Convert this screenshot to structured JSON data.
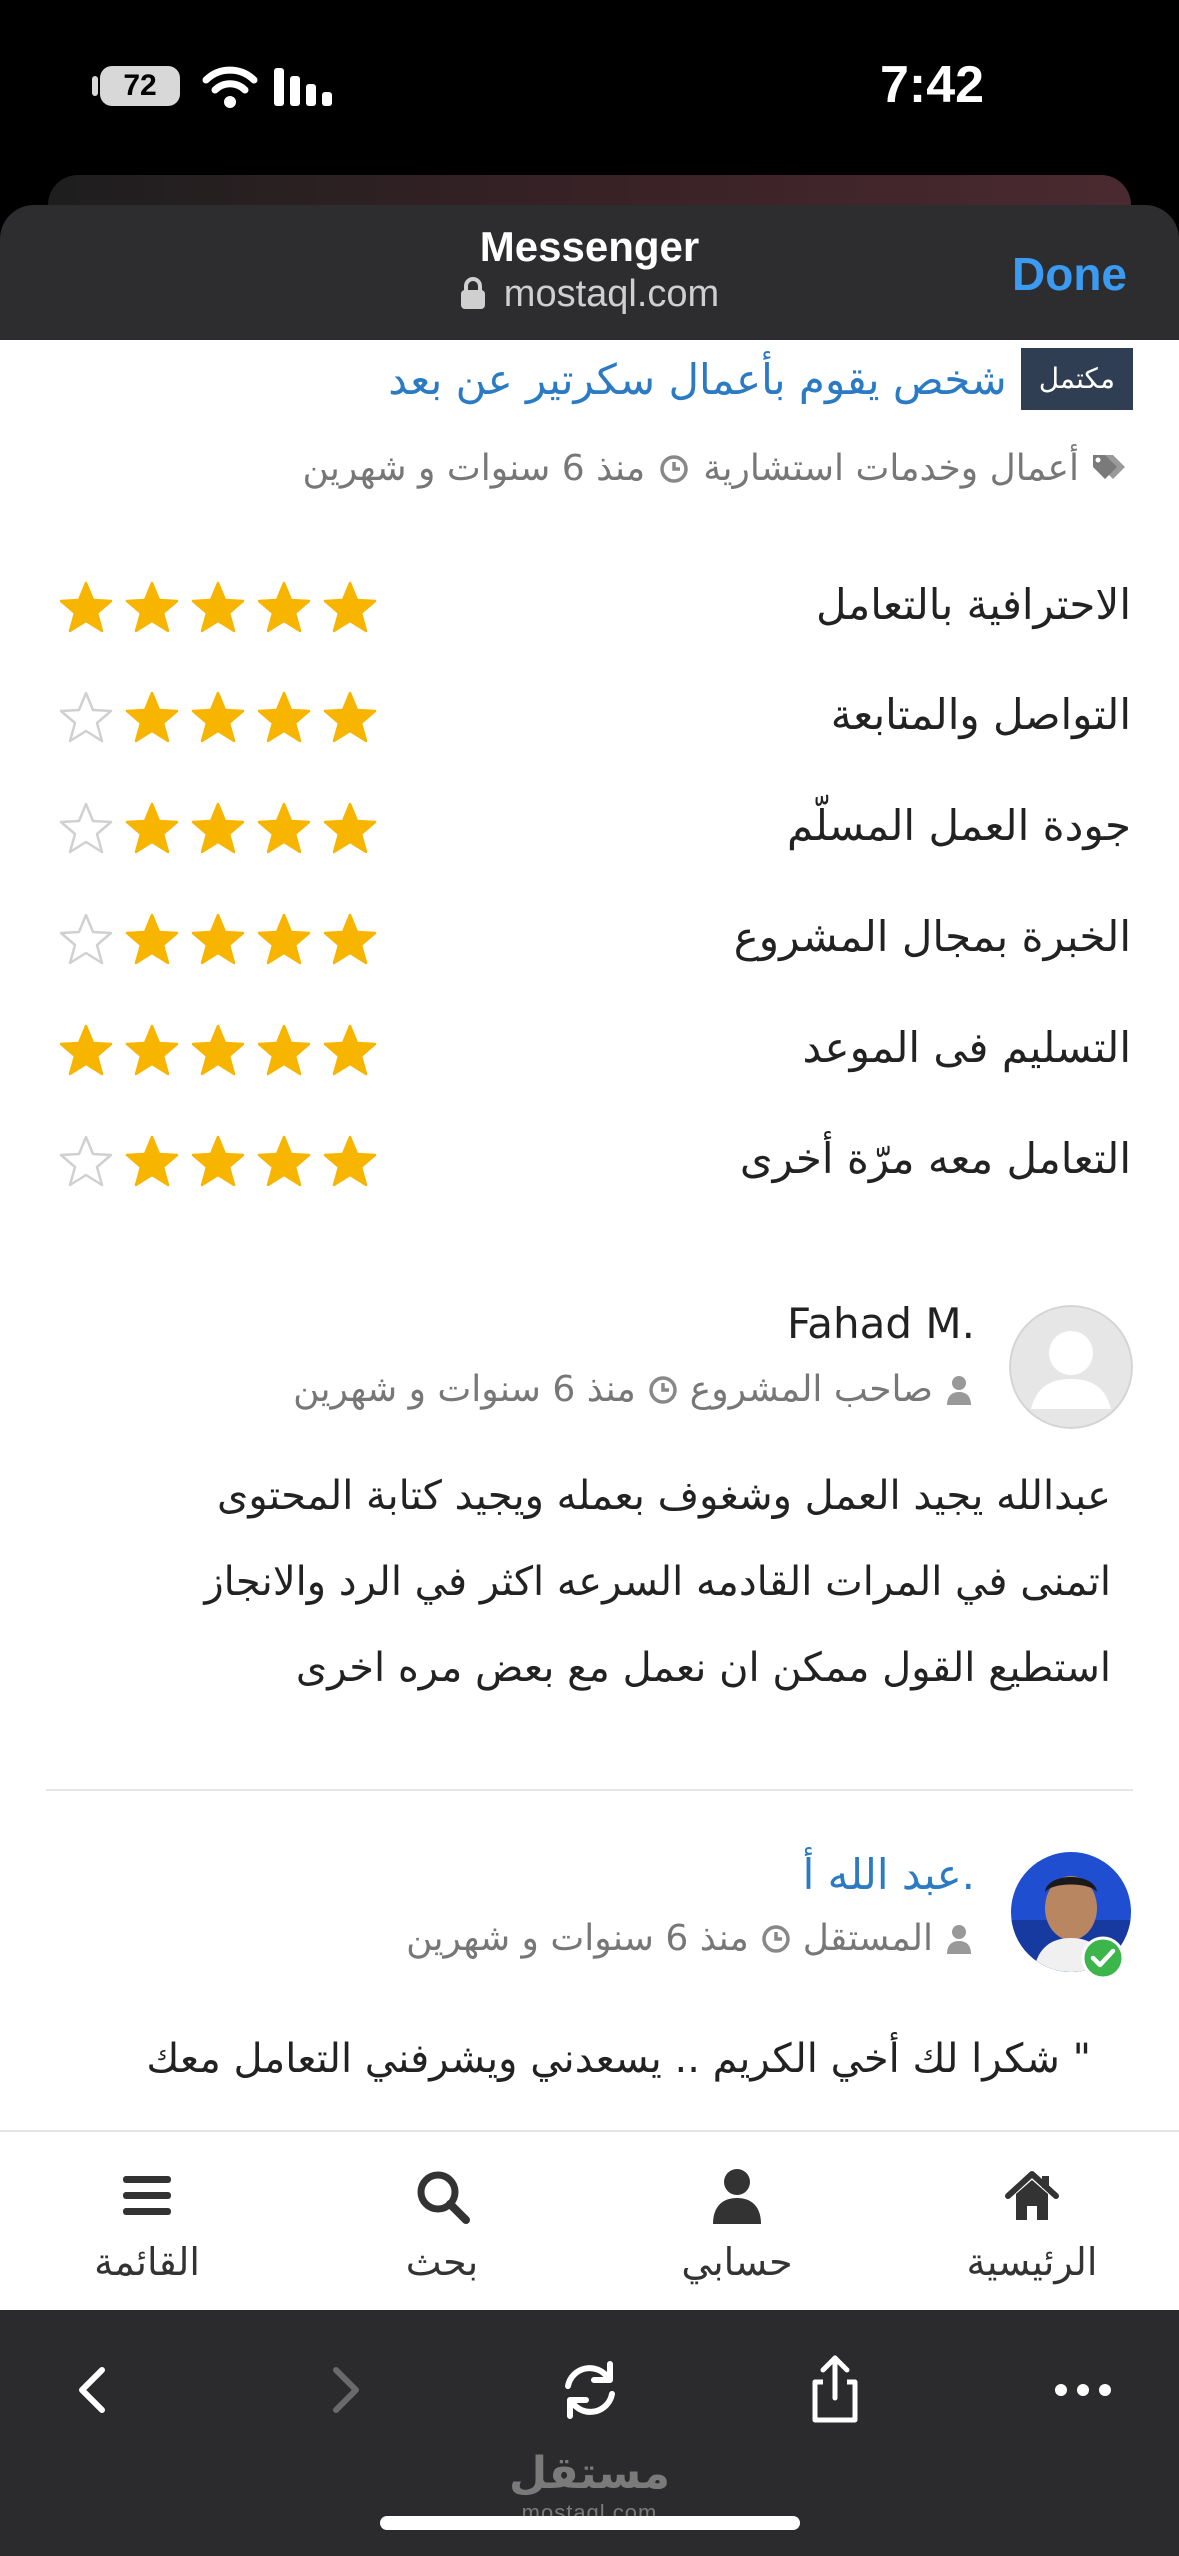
{
  "status_bar": {
    "battery": "72",
    "time": "7:42"
  },
  "sheet": {
    "title": "Messenger",
    "url": "mostaql.com",
    "done_label": "Done"
  },
  "project": {
    "badge": "مكتمل",
    "title": "شخص يقوم بأعمال سكرتير عن بعد",
    "category": "أعمال وخدمات استشارية",
    "time": "منذ 6 سنوات و شهرين"
  },
  "ratings": [
    {
      "label": "الاحترافية بالتعامل",
      "stars": 5
    },
    {
      "label": "التواصل والمتابعة",
      "stars": 4
    },
    {
      "label": "جودة العمل المسلّم",
      "stars": 4
    },
    {
      "label": "الخبرة بمجال المشروع",
      "stars": 4
    },
    {
      "label": "التسليم فى الموعد",
      "stars": 5
    },
    {
      "label": "التعامل معه مرّة أخرى",
      "stars": 4
    }
  ],
  "colors": {
    "star_filled": "#f7b500",
    "star_empty": "#d0d0d0",
    "link": "#2a7ac4",
    "verified": "#3cb54a"
  },
  "review_owner": {
    "name": "Fahad M.",
    "role": "صاحب المشروع",
    "time": "منذ 6 سنوات و شهرين",
    "lines": [
      "عبدالله يجيد العمل وشغوف بعمله ويجيد كتابة المحتوى",
      "اتمنى في المرات القادمه السرعه اكثر في الرد والانجاز",
      "استطيع القول ممكن ان نعمل مع بعض مره اخرى"
    ]
  },
  "review_freelancer": {
    "name": "عبد الله أ.",
    "role": "المستقل",
    "time": "منذ 6 سنوات و شهرين",
    "lines": [
      "\" شكرا لك أخي الكريم .. يسعدني ويشرفني التعامل معك"
    ]
  },
  "tabbar": [
    {
      "label": "الرئيسية",
      "icon": "home-icon"
    },
    {
      "label": "حسابي",
      "icon": "user-icon"
    },
    {
      "label": "بحث",
      "icon": "search-icon"
    },
    {
      "label": "القائمة",
      "icon": "menu-icon"
    }
  ],
  "branding": {
    "arabic": "مستقل",
    "english": "mostaql.com"
  }
}
